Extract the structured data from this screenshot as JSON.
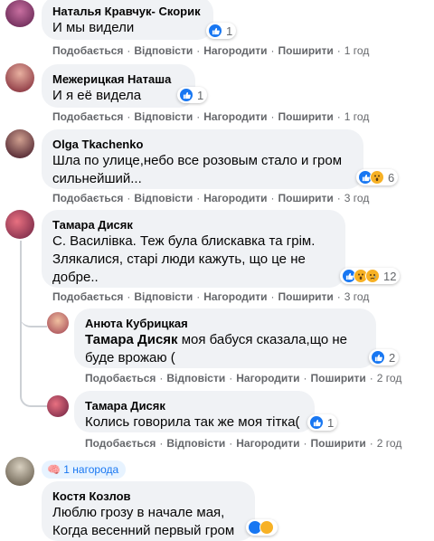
{
  "actions": {
    "like": "Подобається",
    "reply": "Відповісти",
    "reward": "Нагородити",
    "share": "Поширити"
  },
  "colors": {
    "like_blue": "#1877f2",
    "bubble_bg": "#f0f2f5",
    "meta_gray": "#65676b"
  },
  "comments": [
    {
      "author": "Наталья Кравчук- Скорик",
      "text": "И мы видели",
      "time": "1 год",
      "reactions": "1"
    },
    {
      "author": "Межерицкая Наташа",
      "text": "И я её видела",
      "time": "1 год",
      "reactions": "1"
    },
    {
      "author": "Olga Tkachenko",
      "text_line1": "Шла по улице,небо все розовым стало и гром",
      "text_line2": "сильнейший...",
      "time": "3 год",
      "reactions": "6"
    },
    {
      "author": "Тамара Дисяк",
      "text_line1": "С. Василівка. Теж була блискавка та грім.",
      "text_line2": "Злякалися, старі люди кажуть, що це не",
      "text_line3": "добре..",
      "time": "3 год",
      "reactions": "12"
    },
    {
      "author": "Анюта Кубрицкая",
      "mention": "Тамара Дисяк",
      "text_line1": " моя бабуся сказала,що не",
      "text_line2": "буде врожаю (",
      "time": "2 год",
      "reactions": "2"
    },
    {
      "author": "Тамара Дисяк",
      "text": "Колись говорила так же моя тітка(",
      "time": "2 год",
      "reactions": "1"
    },
    {
      "author": "Костя Козлов",
      "text_line1": "Люблю грозу в начале мая,",
      "text_line2": "Когда весенний первый гром",
      "award": "1 нагорода"
    }
  ]
}
